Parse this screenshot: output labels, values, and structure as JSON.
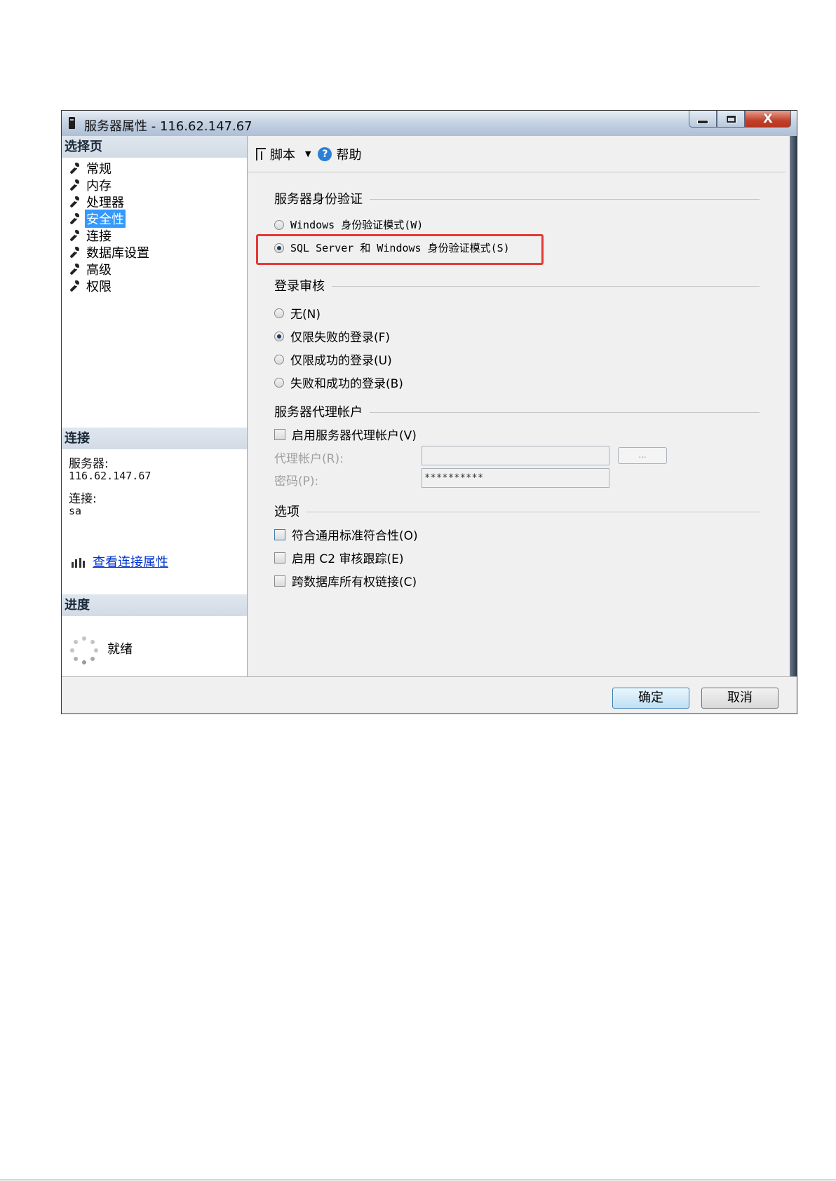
{
  "window": {
    "title": "服务器属性 - 116.62.147.67",
    "controls": {
      "minimize_icon": "minimize-icon",
      "maximize_icon": "maximize-icon",
      "close_glyph": "X"
    }
  },
  "left_pane": {
    "select_page_header": "选择页",
    "pages": [
      {
        "label": "常规",
        "icon": "wrench-icon"
      },
      {
        "label": "内存",
        "icon": "wrench-icon"
      },
      {
        "label": "处理器",
        "icon": "wrench-icon"
      },
      {
        "label": "安全性",
        "icon": "wrench-icon",
        "selected": true
      },
      {
        "label": "连接",
        "icon": "wrench-icon"
      },
      {
        "label": "数据库设置",
        "icon": "wrench-icon"
      },
      {
        "label": "高级",
        "icon": "wrench-icon"
      },
      {
        "label": "权限",
        "icon": "wrench-icon"
      }
    ],
    "connection_header": "连接",
    "server_label": "服务器:",
    "server_value": "116.62.147.67",
    "connection_label": "连接:",
    "connection_value": "sa",
    "view_connection_link": "查看连接属性",
    "progress_header": "进度",
    "progress_status": "就绪"
  },
  "toolbar": {
    "script_label": "脚本",
    "help_label": "帮助"
  },
  "server_auth": {
    "header": "服务器身份验证",
    "windows_mode_label": "Windows 身份验证模式(W)",
    "mixed_mode_label": "SQL Server 和 Windows 身份验证模式(S)",
    "selected": "mixed"
  },
  "login_audit": {
    "header": "登录审核",
    "options": [
      {
        "label": "无(N)",
        "checked": false
      },
      {
        "label": "仅限失败的登录(F)",
        "checked": true
      },
      {
        "label": "仅限成功的登录(U)",
        "checked": false
      },
      {
        "label": "失败和成功的登录(B)",
        "checked": false
      }
    ]
  },
  "proxy_account": {
    "header": "服务器代理帐户",
    "enable_label": "启用服务器代理帐户(V)",
    "account_label": "代理帐户(R):",
    "account_value": "",
    "password_label": "密码(P):",
    "password_value": "**********",
    "browse_label": "..."
  },
  "options": {
    "header": "选项",
    "items": [
      {
        "label": "符合通用标准符合性(O)",
        "checked": false
      },
      {
        "label": "启用 C2 审核跟踪(E)",
        "checked": false
      },
      {
        "label": "跨数据库所有权链接(C)",
        "checked": false
      }
    ]
  },
  "buttons": {
    "ok": "确定",
    "cancel": "取消"
  },
  "colors": {
    "selection": "#3399ff",
    "highlight_box": "#e53935",
    "link": "#0033cc"
  }
}
